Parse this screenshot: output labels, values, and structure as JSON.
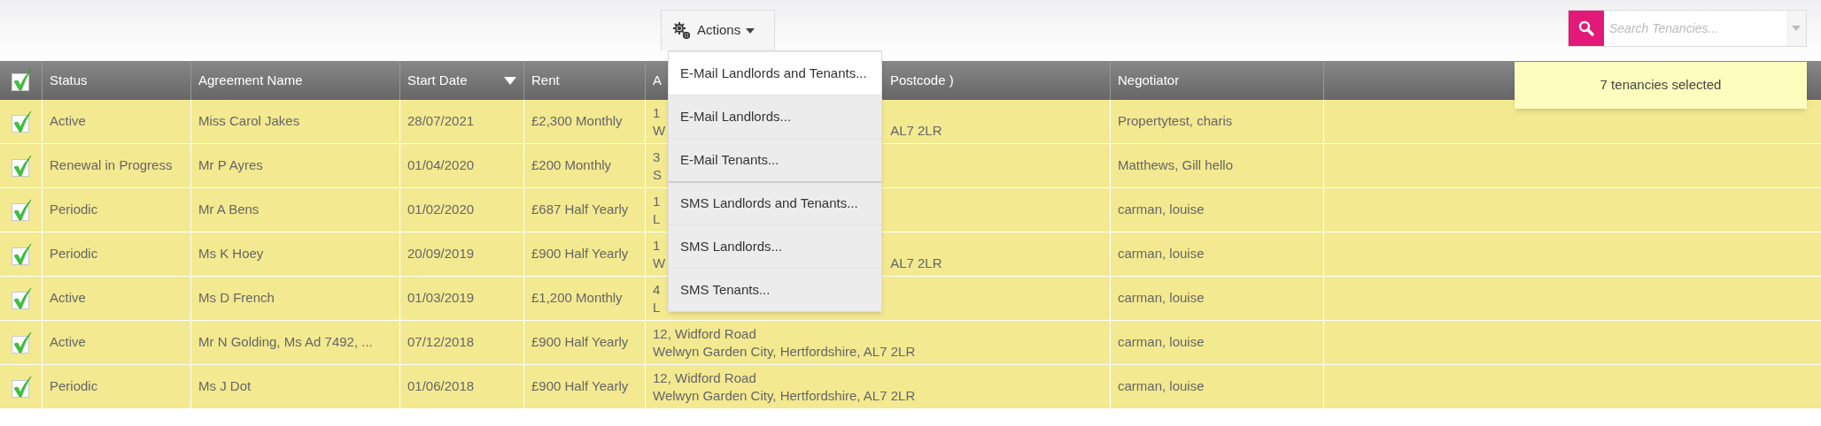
{
  "actions_button": {
    "label": "Actions"
  },
  "actions_menu": [
    {
      "label": "E-Mail Landlords and Tenants...",
      "selected": true,
      "divider_before": false
    },
    {
      "label": "E-Mail Landlords...",
      "selected": false,
      "divider_before": false
    },
    {
      "label": "E-Mail Tenants...",
      "selected": false,
      "divider_before": false
    },
    {
      "label": "SMS Landlords and Tenants...",
      "selected": false,
      "divider_before": true
    },
    {
      "label": "SMS Landlords...",
      "selected": false,
      "divider_before": false
    },
    {
      "label": "SMS Tenants...",
      "selected": false,
      "divider_before": false
    }
  ],
  "search": {
    "placeholder": "Search Tenancies..."
  },
  "selection_notice": "7 tenancies selected",
  "table": {
    "all_checked": true,
    "columns": [
      {
        "label": "Status"
      },
      {
        "label": "Agreement Name"
      },
      {
        "label": "Start Date",
        "sorted": true
      },
      {
        "label": "Rent"
      },
      {
        "label": "A",
        "tail": "Postcode )"
      },
      {
        "label": "Negotiator"
      }
    ],
    "rows": [
      {
        "checked": true,
        "status": "Active",
        "agreement": "Miss Carol Jakes",
        "start_date": "28/07/2021",
        "rent": "£2,300 Monthly",
        "address_line1": "1",
        "address_line2": "W",
        "address_tail": "AL7 2LR",
        "negotiator": "Propertytest, charis"
      },
      {
        "checked": true,
        "status": "Renewal in Progress",
        "agreement": "Mr P Ayres",
        "start_date": "01/04/2020",
        "rent": "£200 Monthly",
        "address_line1": "3",
        "address_line2": "S",
        "negotiator": "Matthews, Gill hello"
      },
      {
        "checked": true,
        "status": "Periodic",
        "agreement": "Mr A Bens",
        "start_date": "01/02/2020",
        "rent": "£687 Half Yearly",
        "address_line1": "1",
        "address_line2": "L",
        "negotiator": "carman, louise"
      },
      {
        "checked": true,
        "status": "Periodic",
        "agreement": "Ms K Hoey",
        "start_date": "20/09/2019",
        "rent": "£900 Half Yearly",
        "address_line1": "1",
        "address_line2": "W",
        "address_tail": "AL7 2LR",
        "negotiator": "carman, louise"
      },
      {
        "checked": true,
        "status": "Active",
        "agreement": "Ms D French",
        "start_date": "01/03/2019",
        "rent": "£1,200 Monthly",
        "address_line1": "4",
        "address_line2": "L",
        "negotiator": "carman, louise"
      },
      {
        "checked": true,
        "status": "Active",
        "agreement": "Mr N Golding, Ms Ad 7492, ...",
        "start_date": "07/12/2018",
        "rent": "£900 Half Yearly",
        "address_line1": "12, Widford Road",
        "address_line2": "Welwyn Garden City, Hertfordshire, AL7 2LR",
        "negotiator": "carman, louise"
      },
      {
        "checked": true,
        "status": "Periodic",
        "agreement": "Ms J Dot",
        "start_date": "01/06/2018",
        "rent": "£900 Half Yearly",
        "address_line1": "12, Widford Road",
        "address_line2": "Welwyn Garden City, Hertfordshire, AL7 2LR",
        "negotiator": "carman, louise"
      }
    ]
  }
}
